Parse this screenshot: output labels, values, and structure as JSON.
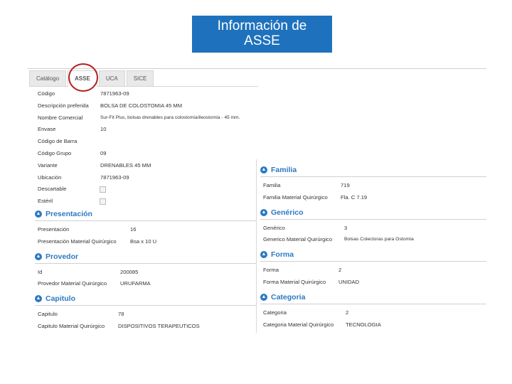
{
  "slide": {
    "title_line1": "Información de",
    "title_line2": "ASSE"
  },
  "tabs": [
    "Catálogo",
    "ASSE",
    "UCA",
    "SICE"
  ],
  "left": {
    "rows": [
      {
        "label": "Código",
        "value": "7871963-09"
      },
      {
        "label": "Descripción preferida",
        "value": "BOLSA DE COLOSTOMIA 45 MM"
      },
      {
        "label": "Nombre Comercial",
        "value": "Sur-Fit Plus, bolsas drenables para colostomía/ileostomía - 45 mm."
      },
      {
        "label": "Envase",
        "value": "10"
      },
      {
        "label": "Código de Barra",
        "value": ""
      },
      {
        "label": "Código Grupo",
        "value": "09"
      },
      {
        "label": "Variante",
        "value": "DRENABLES 45 MM"
      },
      {
        "label": "Ubicación",
        "value": "7871963-09"
      },
      {
        "label": "Descartable",
        "value": ""
      },
      {
        "label": "Estéril",
        "value": ""
      }
    ],
    "presentacion": {
      "title": "Presentación",
      "rows": [
        {
          "label": "Presentación",
          "value": "16"
        },
        {
          "label": "Presentación Material Quirúrgico",
          "value": "Bsa x 10 U"
        }
      ]
    },
    "proveedor": {
      "title": "Provedor",
      "rows": [
        {
          "label": "Id",
          "value": "200085"
        },
        {
          "label": "Provedor Material Quirúrgico",
          "value": "URUFARMA"
        }
      ]
    },
    "capitulo": {
      "title": "Capitulo",
      "rows": [
        {
          "label": "Capitulo",
          "value": "78"
        },
        {
          "label": "Capitulo Material Quirúrgico",
          "value": "DISPOSITIVOS TERAPEUTICOS"
        }
      ]
    }
  },
  "right": {
    "familia": {
      "title": "Familia",
      "rows": [
        {
          "label": "Familia",
          "value": "719"
        },
        {
          "label": "Familia Material Quirúrgico",
          "value": "Fla. C 7.19"
        }
      ]
    },
    "generico": {
      "title": "Genérico",
      "rows": [
        {
          "label": "Genérico",
          "value": "3"
        },
        {
          "label": "Generico Material Quirúrgico",
          "value": "Bolsas Colectoras para Ostomía"
        }
      ]
    },
    "forma": {
      "title": "Forma",
      "rows": [
        {
          "label": "Forma",
          "value": "2"
        },
        {
          "label": "Forma Material Quirúrgico",
          "value": "UNIDAD"
        }
      ]
    },
    "categoria": {
      "title": "Categoria",
      "rows": [
        {
          "label": "Categoria",
          "value": "2"
        },
        {
          "label": "Categoria Material Quirúrgico",
          "value": "TECNOLOGIA"
        }
      ]
    }
  }
}
